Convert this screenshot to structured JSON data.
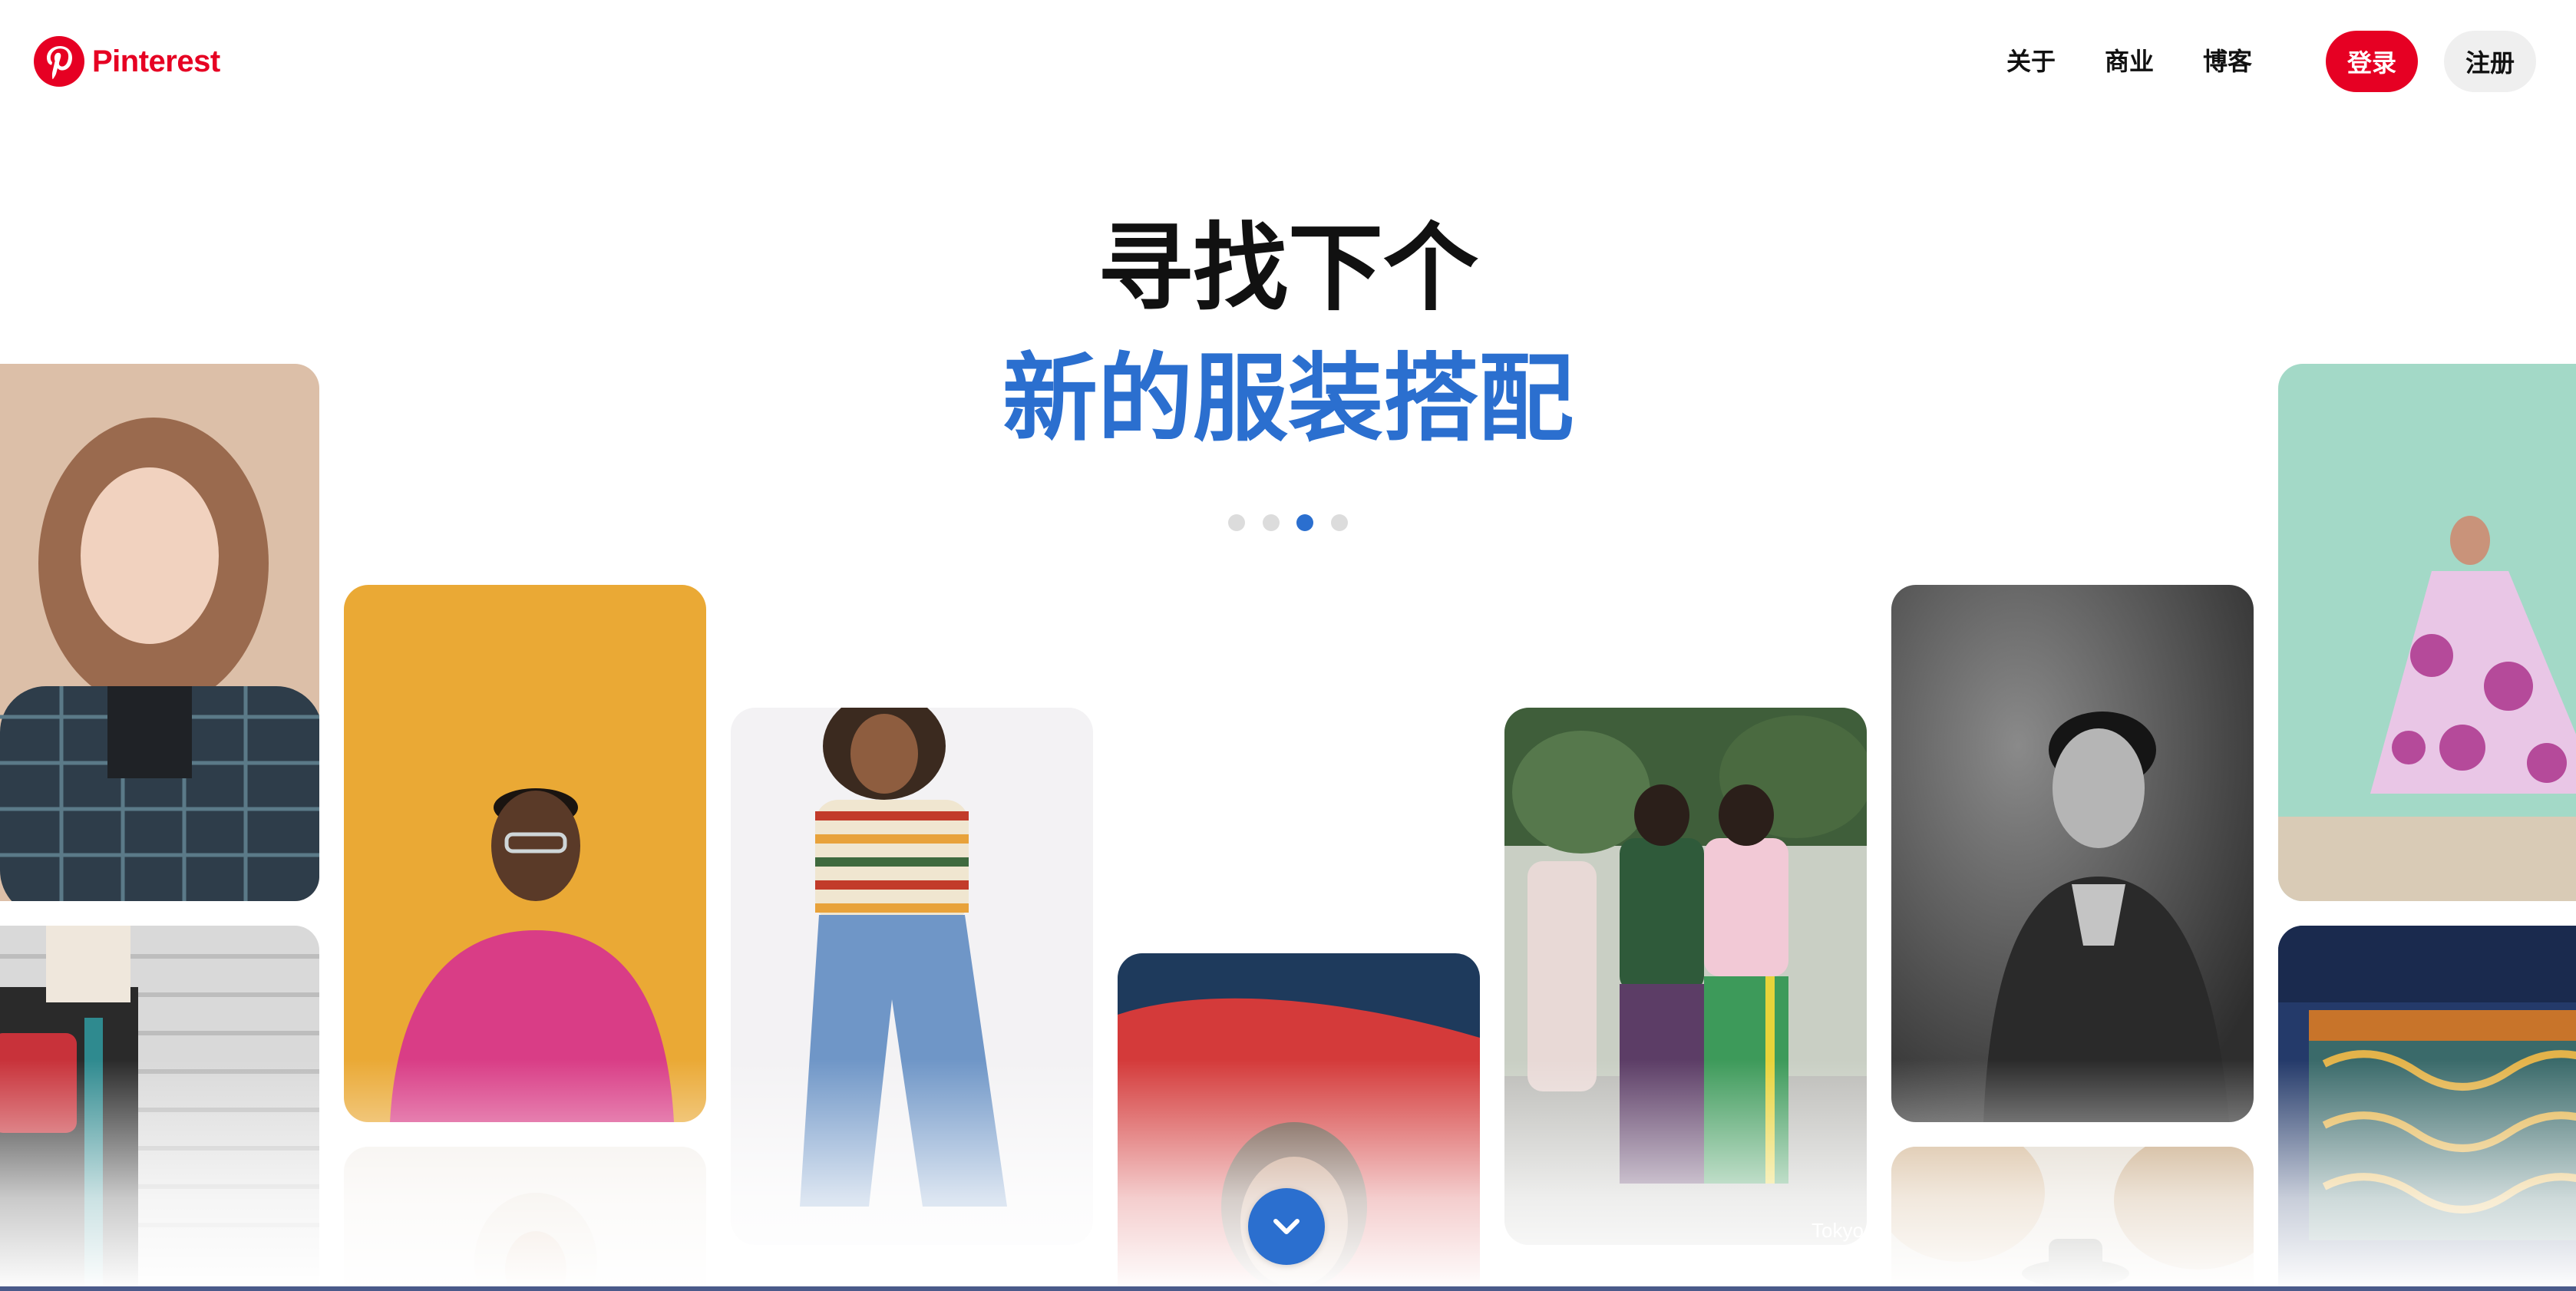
{
  "header": {
    "logo_text": "Pinterest",
    "nav": [
      {
        "label": "关于"
      },
      {
        "label": "商业"
      },
      {
        "label": "博客"
      }
    ],
    "login_label": "登录",
    "signup_label": "注册"
  },
  "hero": {
    "line1": "寻找下个",
    "line2": "新的服装搭配",
    "carousel": {
      "count": 4,
      "active_index": 2
    }
  },
  "colors": {
    "brand_red": "#e60023",
    "accent_blue": "#2b6fcf",
    "heading": "#111111",
    "signup_bg": "#efefef"
  },
  "icons": {
    "logo": "pinterest-logo-icon",
    "scroll_down": "chevron-down-icon"
  },
  "pins": [
    {
      "name": "pin-woman-wavy-hair-plaid-coat"
    },
    {
      "name": "pin-man-pink-sweater-yellow-background"
    },
    {
      "name": "pin-woman-striped-tee-denim"
    },
    {
      "name": "pin-woman-red-fabric"
    },
    {
      "name": "pin-two-women-street-style"
    },
    {
      "name": "pin-man-black-and-white-portrait"
    },
    {
      "name": "pin-woman-floral-dress-mint-wall"
    },
    {
      "name": "pin-person-red-bag-street"
    },
    {
      "name": "pin-woman-headscarf"
    },
    {
      "name": "pin-autumn-trees-hat"
    },
    {
      "name": "pin-denim-patterned-fabric"
    }
  ],
  "pin_watermark": "Tokyo"
}
